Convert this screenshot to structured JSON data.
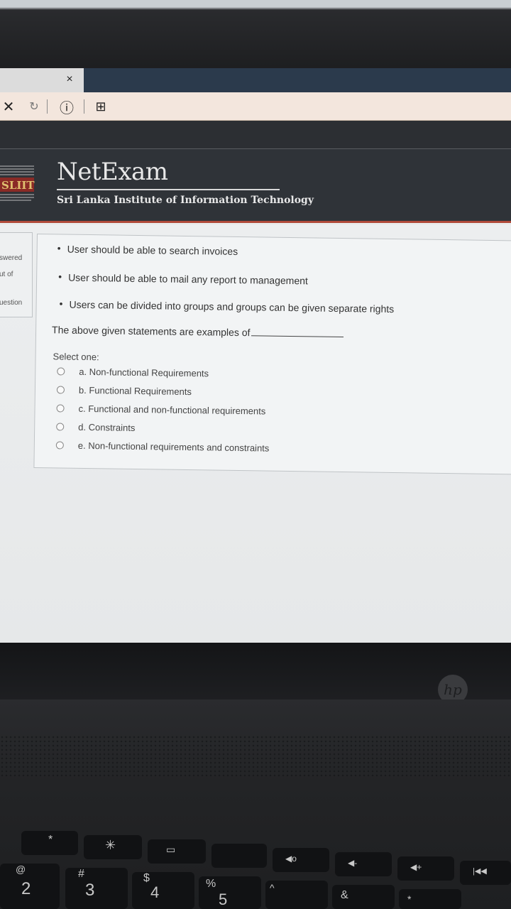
{
  "browser": {
    "tab_close": "×",
    "toolbar": {
      "close": "✕",
      "reload": "↻",
      "info": "ⓘ",
      "page_action": "⊞"
    }
  },
  "header": {
    "logo_text": "SLIIT",
    "brand": "NetExam",
    "subtitle": "Sri Lanka Institute of Information Technology"
  },
  "question_nav": {
    "line1": "swered",
    "line2": "ut of",
    "line3": "uestion"
  },
  "question": {
    "statements": [
      "User should be able to search invoices",
      "User should be able to mail any report to management",
      "Users can be divided into groups and groups can be given separate rights"
    ],
    "prompt": "The above given statements are examples of",
    "select_label": "Select one:",
    "options": [
      "a. Non-functional Requirements",
      "b. Functional Requirements",
      "c. Functional and non-functional requirements",
      "d. Constraints",
      "e. Non-functional requirements and constraints"
    ]
  },
  "laptop": {
    "brand": "hp",
    "keys": [
      {
        "top": "*",
        "bottom": "2",
        "alt": "@"
      },
      {
        "top": "✳",
        "bottom": "3",
        "alt": "#"
      },
      {
        "top": "▭",
        "bottom": "4",
        "alt": "$"
      },
      {
        "top": "",
        "bottom": "5",
        "alt": "%"
      },
      {
        "top": "◀ο",
        "bottom": "",
        "alt": "^"
      },
      {
        "top": "◀-",
        "bottom": "",
        "alt": "&"
      },
      {
        "top": "◀+",
        "bottom": "",
        "alt": "*"
      },
      {
        "top": "|◀◀",
        "bottom": "",
        "alt": ""
      }
    ]
  }
}
